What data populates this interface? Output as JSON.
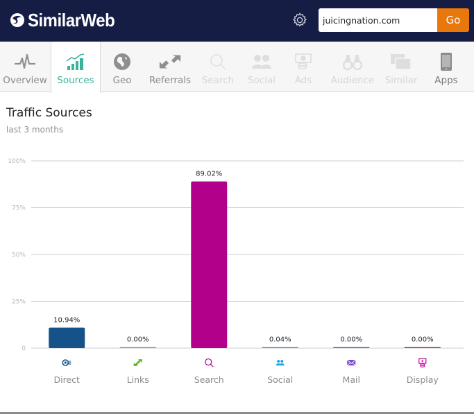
{
  "header": {
    "brand": "SimilarWeb",
    "search_value": "juicingnation.com",
    "go_label": "Go",
    "colors": {
      "background": "#161d45",
      "go_button": "#e8780b"
    }
  },
  "nav": {
    "items": [
      {
        "label": "Overview",
        "icon": "pulse-icon",
        "state": "normal"
      },
      {
        "label": "Sources",
        "icon": "bar-chart-icon",
        "state": "active"
      },
      {
        "label": "Geo",
        "icon": "globe-icon",
        "state": "normal"
      },
      {
        "label": "Referrals",
        "icon": "arrows-icon",
        "state": "normal"
      },
      {
        "label": "Search",
        "icon": "magnifier-icon",
        "state": "disabled"
      },
      {
        "label": "Social",
        "icon": "people-icon",
        "state": "disabled"
      },
      {
        "label": "Ads",
        "icon": "money-icon",
        "state": "disabled"
      },
      {
        "label": "Audience",
        "icon": "binoculars-icon",
        "state": "disabled"
      },
      {
        "label": "Similar",
        "icon": "windows-icon",
        "state": "disabled"
      },
      {
        "label": "Apps",
        "icon": "phone-icon",
        "state": "normal"
      }
    ],
    "active_color": "#3bb39a"
  },
  "content": {
    "title": "Traffic Sources",
    "subtitle": "last 3 months"
  },
  "chart_data": {
    "type": "bar",
    "title": "Traffic Sources",
    "subtitle": "last 3 months",
    "xlabel": "",
    "ylabel": "",
    "ylim": [
      0,
      100
    ],
    "y_ticks": [
      0,
      25,
      50,
      75,
      100
    ],
    "y_tick_labels": [
      "0",
      "25%",
      "50%",
      "75%",
      "100%"
    ],
    "grid": true,
    "categories": [
      "Direct",
      "Links",
      "Search",
      "Social",
      "Mail",
      "Display"
    ],
    "values": [
      10.94,
      0.0,
      89.02,
      0.04,
      0.0,
      0.0
    ],
    "value_labels": [
      "10.94%",
      "0.00%",
      "89.02%",
      "0.04%",
      "0.00%",
      "0.00%"
    ],
    "colors": [
      "#16528a",
      "#5fb82a",
      "#b3008a",
      "#2a9fe0",
      "#7a45d0",
      "#c0109e"
    ],
    "icons": [
      "direct-icon",
      "links-icon",
      "search-icon",
      "social-icon",
      "mail-icon",
      "display-icon"
    ]
  }
}
